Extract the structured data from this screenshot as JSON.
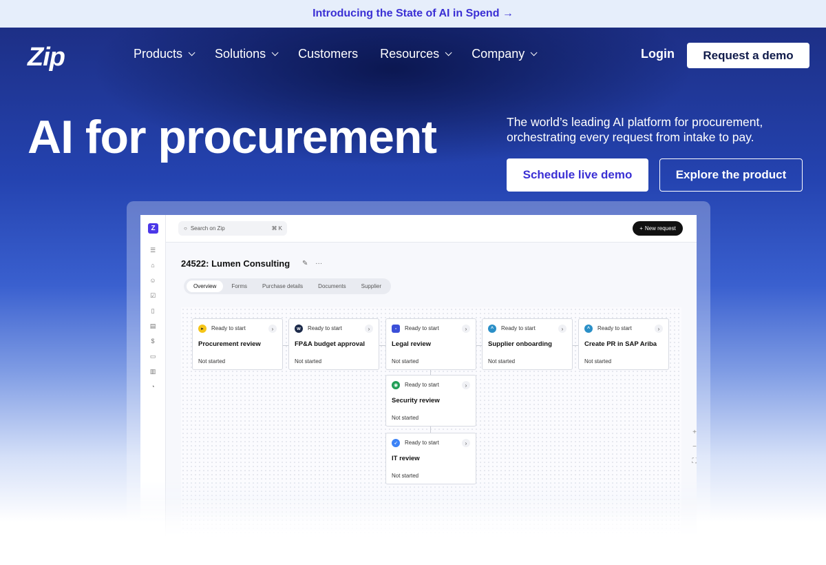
{
  "announcement": "Introducing the State of AI in Spend →",
  "logo": "Zip",
  "nav": [
    {
      "label": "Products",
      "has_menu": true
    },
    {
      "label": "Solutions",
      "has_menu": true
    },
    {
      "label": "Customers",
      "has_menu": false
    },
    {
      "label": "Resources",
      "has_menu": true
    },
    {
      "label": "Company",
      "has_menu": true
    }
  ],
  "header": {
    "login": "Login",
    "request_demo": "Request a demo"
  },
  "hero": {
    "headline": "AI for procurement",
    "tagline": "The world’s leading AI platform for procurement, orchestrating every request from intake to pay.",
    "primary_cta": "Schedule live demo",
    "secondary_cta": "Explore the product"
  },
  "app": {
    "logo_letter": "Z",
    "search_placeholder": "Search on Zip",
    "search_shortcut": "⌘ K",
    "new_request": "New request",
    "request_title": "24522: Lumen Consulting",
    "more": "···",
    "tabs": [
      "Overview",
      "Forms",
      "Purchase details",
      "Documents",
      "Supplier"
    ],
    "active_tab": "Overview",
    "cards": [
      {
        "status": "Ready to start",
        "name": "Procurement review",
        "state": "Not started",
        "icon_color": "#f5c518"
      },
      {
        "status": "Ready to start",
        "name": "FP&A budget approval",
        "state": "Not started",
        "icon_color": "#1c2a4a"
      },
      {
        "status": "Ready to start",
        "name": "Legal review",
        "state": "Not started",
        "icon_color": "#3b4fd8"
      },
      {
        "status": "Ready to start",
        "name": "Supplier onboarding",
        "state": "Not started",
        "icon_color": "#2a8fc7"
      },
      {
        "status": "Ready to start",
        "name": "Create PR in SAP Ariba",
        "state": "Not started",
        "icon_color": "#2a8fc7"
      },
      {
        "status": "Ready to start",
        "name": "Security review",
        "state": "Not started",
        "icon_color": "#1f9d55"
      },
      {
        "status": "Ready to start",
        "name": "IT review",
        "state": "Not started",
        "icon_color": "#3b82f6"
      }
    ]
  },
  "colors": {
    "accent": "#3a2fd4",
    "hero_top": "#1d2f86",
    "hero_mid": "#2443b0"
  }
}
